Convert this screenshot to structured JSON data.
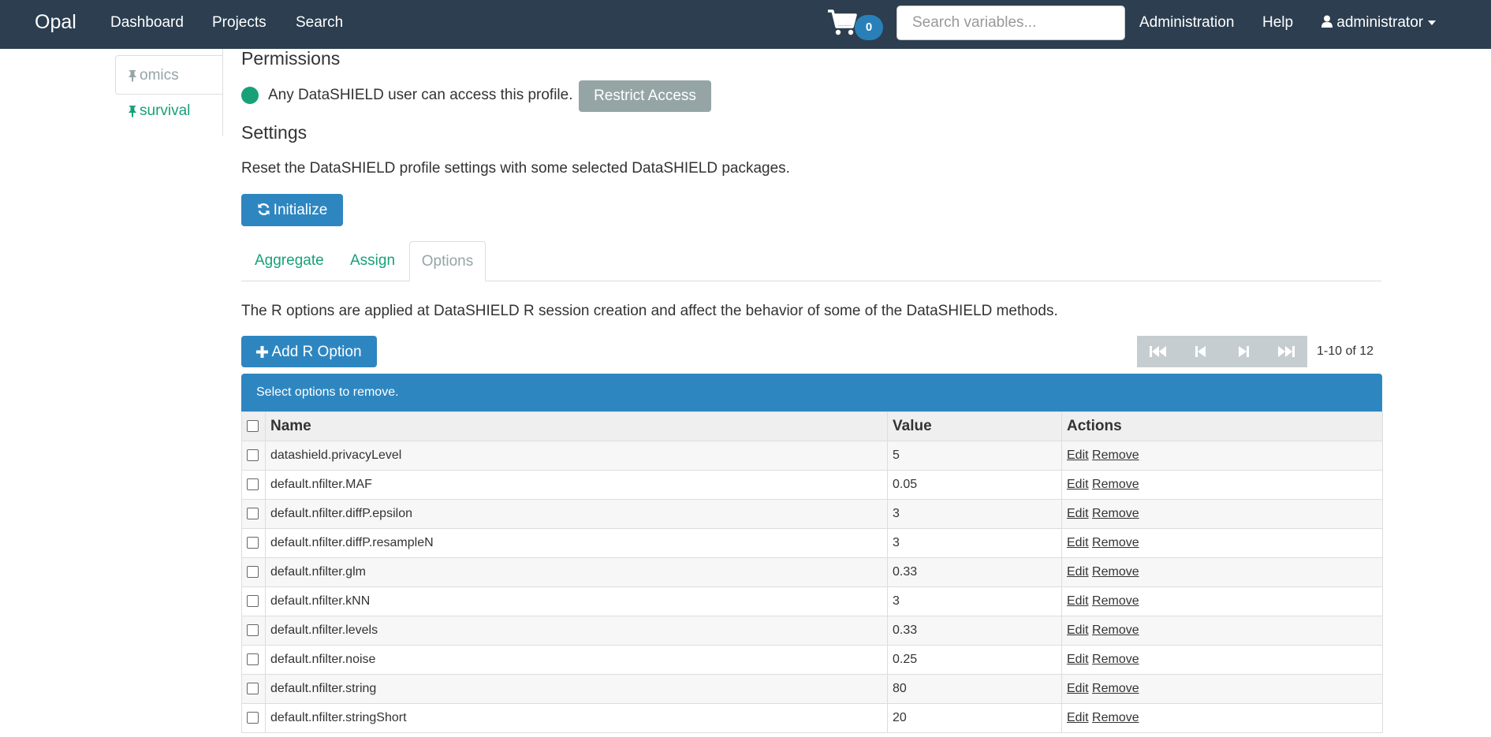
{
  "navbar": {
    "brand": "Opal",
    "links": [
      "Dashboard",
      "Projects",
      "Search"
    ],
    "cart_count": "0",
    "search_placeholder": "Search variables...",
    "admin": "Administration",
    "help": "Help",
    "user": "administrator"
  },
  "side_nav": {
    "items": [
      {
        "label": "omics",
        "active": true
      },
      {
        "label": "survival",
        "active": false
      }
    ]
  },
  "permissions": {
    "heading": "Permissions",
    "status_text": "Any DataSHIELD user can access this profile.",
    "status_color": "#18a079",
    "restrict_button": "Restrict Access"
  },
  "settings": {
    "heading": "Settings",
    "description": "Reset the DataSHIELD profile settings with some selected DataSHIELD packages.",
    "initialize_button": "Initialize"
  },
  "tabs": [
    {
      "label": "Aggregate",
      "active": false
    },
    {
      "label": "Assign",
      "active": false
    },
    {
      "label": "Options",
      "active": true
    }
  ],
  "options": {
    "description": "The R options are applied at DataSHIELD R session creation and affect the behavior of some of the DataSHIELD methods.",
    "add_button": "Add R Option",
    "pager_text": "1-10 of 12",
    "banner": "Select options to remove.",
    "columns": [
      "Name",
      "Value",
      "Actions"
    ],
    "actions": [
      "Edit",
      "Remove"
    ],
    "rows": [
      {
        "name": "datashield.privacyLevel",
        "value": "5"
      },
      {
        "name": "default.nfilter.MAF",
        "value": "0.05"
      },
      {
        "name": "default.nfilter.diffP.epsilon",
        "value": "3"
      },
      {
        "name": "default.nfilter.diffP.resampleN",
        "value": "3"
      },
      {
        "name": "default.nfilter.glm",
        "value": "0.33"
      },
      {
        "name": "default.nfilter.kNN",
        "value": "3"
      },
      {
        "name": "default.nfilter.levels",
        "value": "0.33"
      },
      {
        "name": "default.nfilter.noise",
        "value": "0.25"
      },
      {
        "name": "default.nfilter.string",
        "value": "80"
      },
      {
        "name": "default.nfilter.stringShort",
        "value": "20"
      }
    ]
  },
  "colors": {
    "navbar": "#2c3e50",
    "primary": "#2e86c1",
    "success": "#18a079",
    "muted": "#95a5a6"
  }
}
